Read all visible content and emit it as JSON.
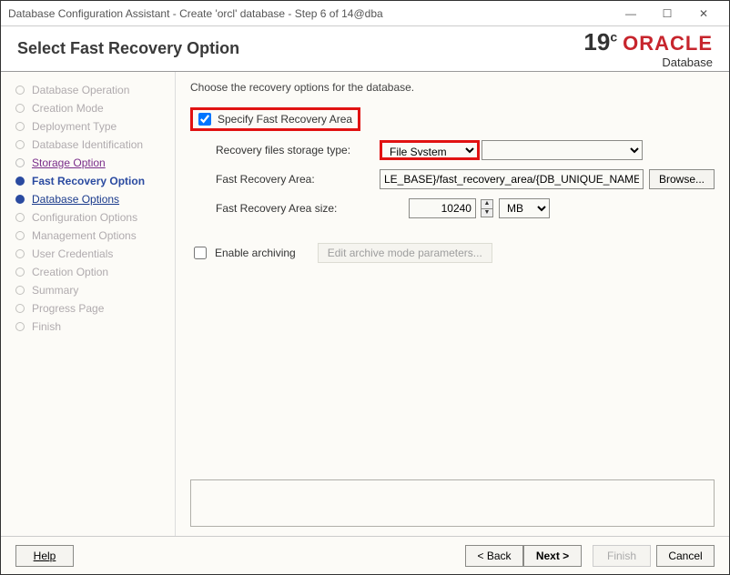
{
  "window": {
    "title": "Database Configuration Assistant - Create 'orcl' database - Step 6 of 14@dba"
  },
  "header": {
    "title": "Select Fast Recovery Option",
    "brand_version": "19",
    "brand_version_sup": "c",
    "brand_name": "ORACLE",
    "brand_sub": "Database"
  },
  "sidebar": {
    "items": [
      {
        "label": "Database Operation"
      },
      {
        "label": "Creation Mode"
      },
      {
        "label": "Deployment Type"
      },
      {
        "label": "Database Identification"
      },
      {
        "label": "Storage Option"
      },
      {
        "label": "Fast Recovery Option"
      },
      {
        "label": "Database Options"
      },
      {
        "label": "Configuration Options"
      },
      {
        "label": "Management Options"
      },
      {
        "label": "User Credentials"
      },
      {
        "label": "Creation Option"
      },
      {
        "label": "Summary"
      },
      {
        "label": "Progress Page"
      },
      {
        "label": "Finish"
      }
    ]
  },
  "main": {
    "instruction": "Choose the recovery options for the database.",
    "specify_fra_label": "Specify Fast Recovery Area",
    "storage_type_label": "Recovery files storage type:",
    "storage_type_value": "File System",
    "fra_label": "Fast Recovery Area:",
    "fra_value": "LE_BASE}/fast_recovery_area/{DB_UNIQUE_NAME}",
    "browse_label": "Browse...",
    "fra_size_label": "Fast Recovery Area size:",
    "fra_size_value": "10240",
    "fra_size_unit": "MB",
    "enable_archiving_label": "Enable archiving",
    "edit_params_label": "Edit archive mode parameters..."
  },
  "footer": {
    "help": "Help",
    "back": "< Back",
    "next": "Next >",
    "finish": "Finish",
    "cancel": "Cancel"
  }
}
